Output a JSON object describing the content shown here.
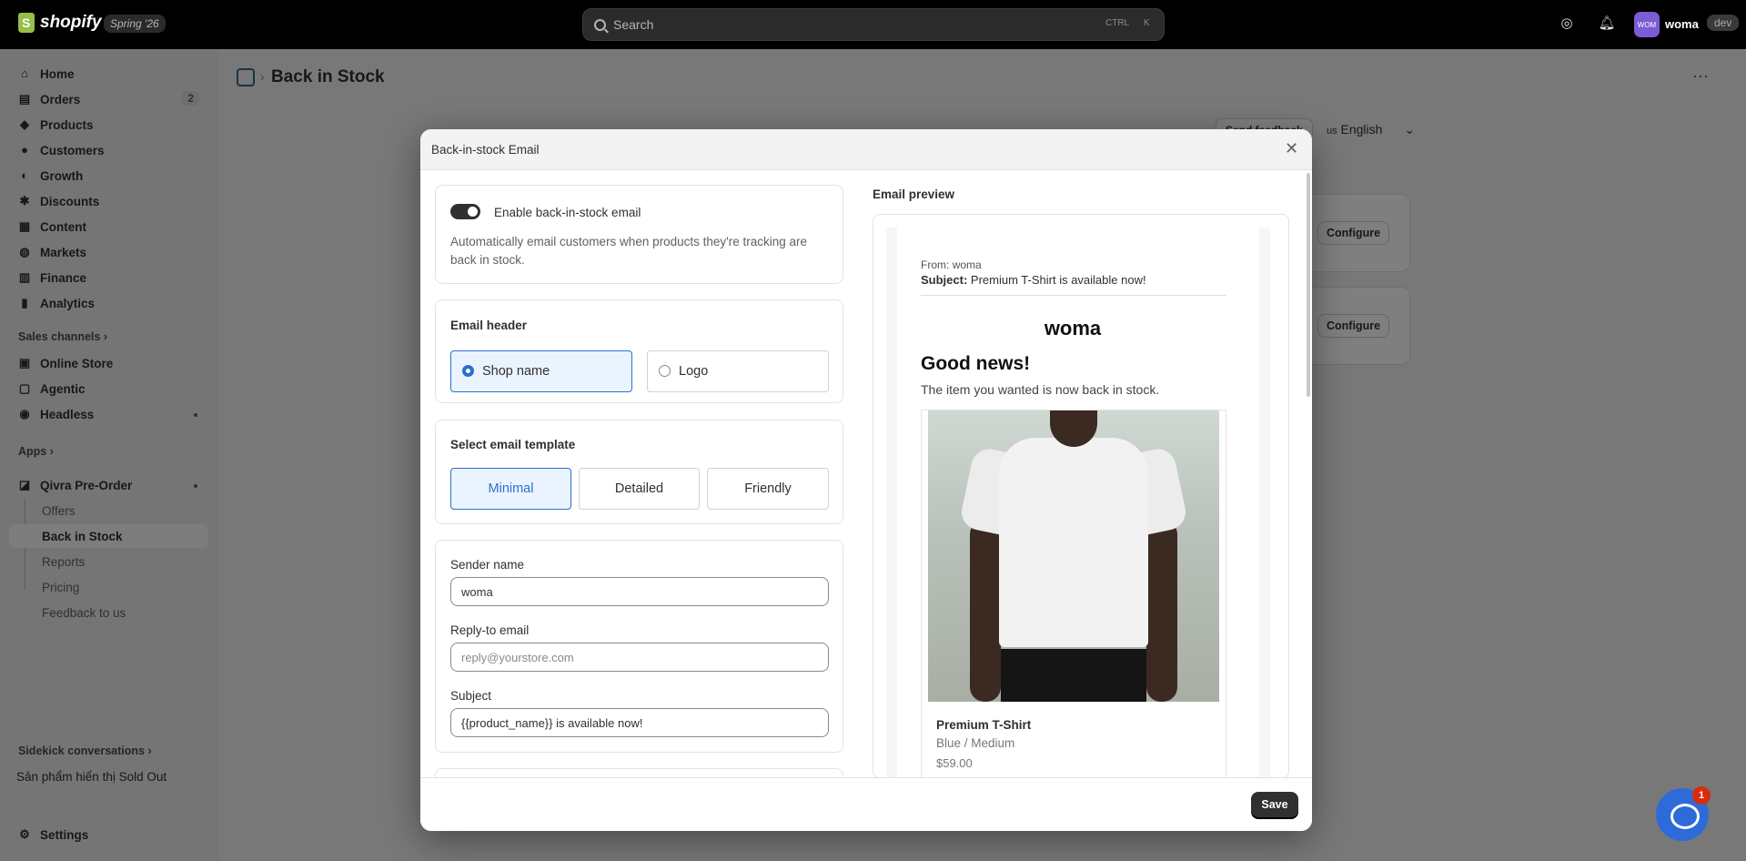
{
  "topbar": {
    "brand": "shopify",
    "edition": "Spring '26",
    "search_placeholder": "Search",
    "shortcut_ctrl": "CTRL",
    "shortcut_key": "K",
    "avatar_initials": "WOM",
    "store_name": "woma",
    "store_badge": "dev"
  },
  "sidebar": {
    "items": [
      {
        "label": "Home",
        "icon": "home-icon"
      },
      {
        "label": "Orders",
        "icon": "orders-icon",
        "count": "2"
      },
      {
        "label": "Products",
        "icon": "tag-icon"
      },
      {
        "label": "Customers",
        "icon": "person-icon"
      },
      {
        "label": "Growth",
        "icon": "growth-icon"
      },
      {
        "label": "Discounts",
        "icon": "discount-icon"
      },
      {
        "label": "Content",
        "icon": "content-icon"
      },
      {
        "label": "Markets",
        "icon": "globe-icon"
      },
      {
        "label": "Finance",
        "icon": "finance-icon"
      },
      {
        "label": "Analytics",
        "icon": "analytics-icon"
      }
    ],
    "sales_channels_label": "Sales channels",
    "channels": [
      {
        "label": "Online Store",
        "icon": "store-icon"
      },
      {
        "label": "Agentic",
        "icon": "agentic-icon"
      },
      {
        "label": "Headless",
        "icon": "headless-icon"
      }
    ],
    "apps_label": "Apps",
    "app": {
      "label": "Qivra Pre-Order",
      "icon": "app-icon"
    },
    "app_pages": [
      "Offers",
      "Back in Stock",
      "Reports",
      "Pricing",
      "Feedback to us"
    ],
    "sidekick_label": "Sidekick conversations",
    "sidekick_item": "Sản phẩm hiển thị Sold Out",
    "settings_label": "Settings"
  },
  "page": {
    "title": "Back in Stock",
    "feedback_label": "Send feedback",
    "language": "English",
    "language_prefix": "us",
    "configure_label": "Configure"
  },
  "modal": {
    "title": "Back-in-stock Email",
    "enable_label": "Enable back-in-stock email",
    "enable_desc": "Automatically email customers when products they're tracking are back in stock.",
    "header_section": "Email header",
    "header_options": [
      "Shop name",
      "Logo"
    ],
    "template_section": "Select email template",
    "templates": [
      "Minimal",
      "Detailed",
      "Friendly"
    ],
    "sender_label": "Sender name",
    "sender_value": "woma",
    "reply_label": "Reply-to email",
    "reply_placeholder": "reply@yourstore.com",
    "subject_label": "Subject",
    "subject_value": "{{product_name}} is available now!",
    "save_label": "Save",
    "preview_title": "Email preview"
  },
  "preview": {
    "from_label": "From:",
    "from_value": "woma",
    "subject_label": "Subject:",
    "subject_value": "Premium T-Shirt is available now!",
    "shop_name": "woma",
    "headline": "Good news!",
    "body": "The item you wanted is now back in stock.",
    "product_name": "Premium T-Shirt",
    "variant": "Blue / Medium",
    "price": "$59.00"
  },
  "chat_badge": "1",
  "colors": {
    "accent": "#2c6ecb",
    "primary_button": "#303030",
    "topbar": "#000000"
  }
}
